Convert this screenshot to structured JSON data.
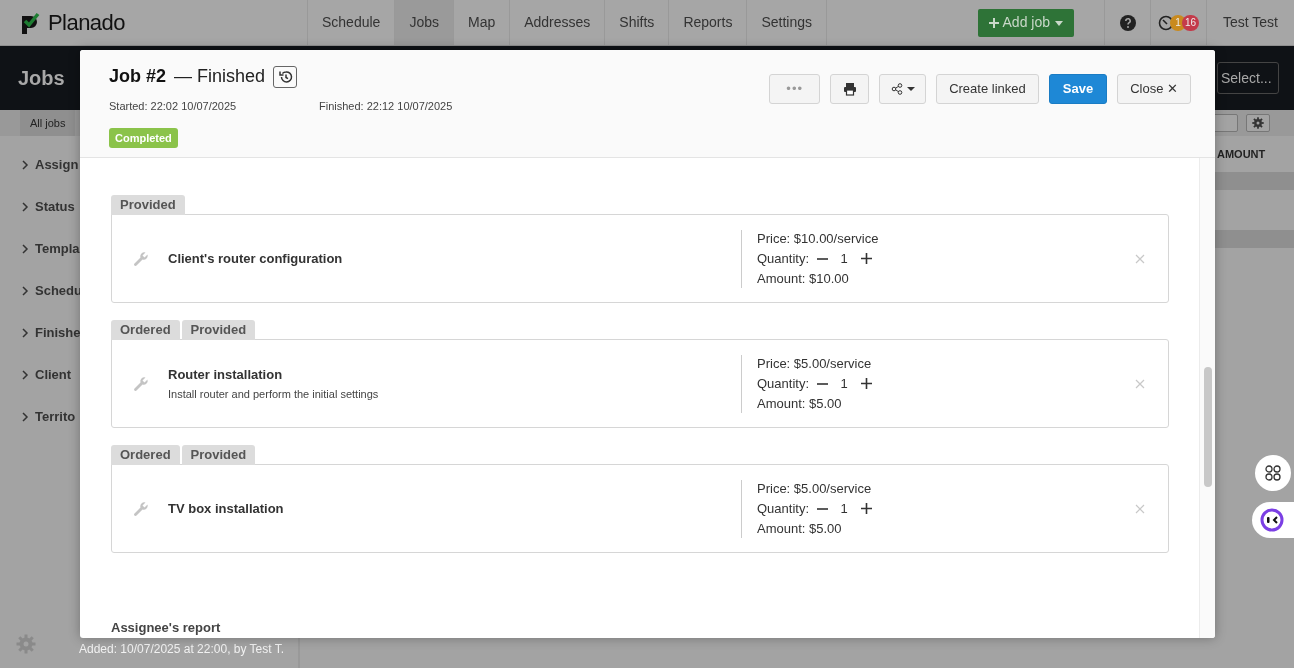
{
  "app": {
    "logo": "Planado",
    "nav": [
      {
        "label": "Schedule",
        "selected": false
      },
      {
        "label": "Jobs",
        "selected": true
      },
      {
        "label": "Map",
        "selected": false
      },
      {
        "label": "Addresses",
        "selected": false
      },
      {
        "label": "Shifts",
        "selected": false
      },
      {
        "label": "Reports",
        "selected": false
      },
      {
        "label": "Settings",
        "selected": false
      }
    ],
    "add_job": "Add job",
    "badges": [
      {
        "count": "1",
        "color": "#c98a1e"
      },
      {
        "count": "16",
        "color": "#c43a4a"
      }
    ],
    "user": "Test Test",
    "page_title": "Jobs",
    "select": "Select...",
    "view_tab": "All jobs",
    "column": "AMOUNT",
    "filters": [
      "Assign",
      "Status",
      "Templa",
      "Schedu",
      "Finishe",
      "Client",
      "Territo"
    ],
    "footer": "Added: 10/07/2025 at 22:00, by Test T."
  },
  "modal": {
    "title": "Job #2",
    "status": "— Finished",
    "started": "Started: 22:02 10/07/2025",
    "finished": "Finished: 22:12 10/07/2025",
    "badge": "Completed",
    "buttons": {
      "more": "•••",
      "create_linked": "Create linked",
      "save": "Save",
      "close": "Close ✕"
    },
    "services": [
      {
        "tags": [
          "Provided"
        ],
        "name": "Client's router configuration",
        "price": "Price: $10.00/service",
        "quantity_label": "Quantity:",
        "quantity": "1",
        "amount": "Amount: $10.00"
      },
      {
        "tags": [
          "Ordered",
          "Provided"
        ],
        "name": "Router installation",
        "description": "Install router and perform the initial settings",
        "price": "Price: $5.00/service",
        "quantity_label": "Quantity:",
        "quantity": "1",
        "amount": "Amount: $5.00"
      },
      {
        "tags": [
          "Ordered",
          "Provided"
        ],
        "name": "TV box installation",
        "price": "Price: $5.00/service",
        "quantity_label": "Quantity:",
        "quantity": "1",
        "amount": "Amount: $5.00"
      }
    ],
    "section": "Assignee's report"
  }
}
